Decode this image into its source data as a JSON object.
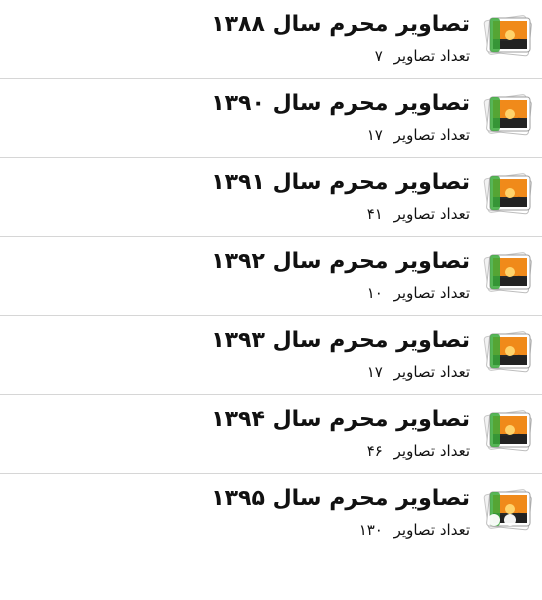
{
  "albums": [
    {
      "title": "تصاویر محرم سال ۱۳۸۸",
      "count_label": "تعداد تصاویر",
      "count": "۷"
    },
    {
      "title": "تصاویر محرم سال ۱۳۹۰",
      "count_label": "تعداد تصاویر",
      "count": "۱۷"
    },
    {
      "title": "تصاویر محرم سال ۱۳۹۱",
      "count_label": "تعداد تصاویر",
      "count": "۴۱"
    },
    {
      "title": "تصاویر محرم سال ۱۳۹۲",
      "count_label": "تعداد تصاویر",
      "count": "۱۰"
    },
    {
      "title": "تصاویر محرم سال ۱۳۹۳",
      "count_label": "تعداد تصاویر",
      "count": "۱۷"
    },
    {
      "title": "تصاویر محرم سال ۱۳۹۴",
      "count_label": "تعداد تصاویر",
      "count": "۴۶"
    },
    {
      "title": "تصاویر محرم سال ۱۳۹۵",
      "count_label": "تعداد تصاویر",
      "count": "۱۳۰"
    }
  ],
  "icons": {
    "thumbnail": "photo-stack-icon",
    "overlay": "app-logo-icon"
  },
  "colors": {
    "divider": "#d6d6d6",
    "text": "#111111",
    "sunset_orange": "#f08a1a",
    "overlay_green": "#3aa93a"
  }
}
